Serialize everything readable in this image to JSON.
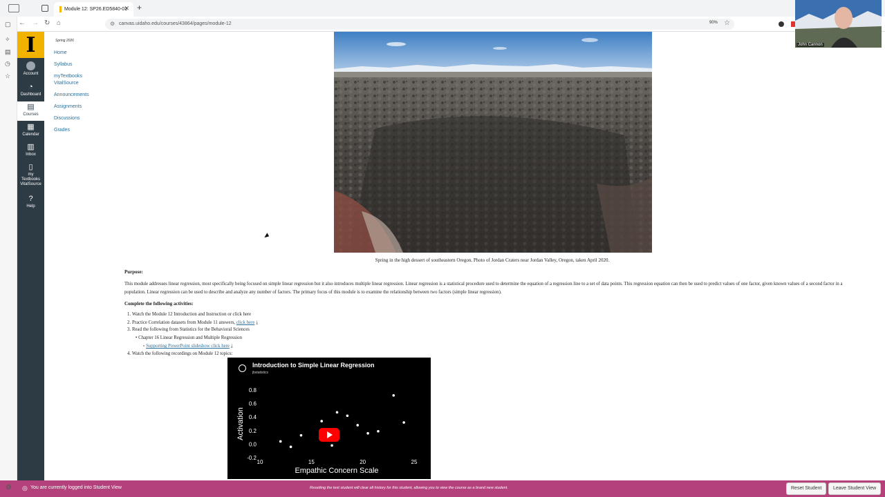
{
  "browser": {
    "tab_title": "Module 12: SP26.ED5840-01",
    "tab_close": "✕",
    "new_tab": "+",
    "url": "canvas.uidaho.edu/courses/43864/pages/module-12",
    "zoom": "90%"
  },
  "global_nav": {
    "logo": "I",
    "items": [
      {
        "label": "Account",
        "icon": "account-icon"
      },
      {
        "label": "Dashboard",
        "icon": "dashboard-icon",
        "glyph": "◔"
      },
      {
        "label": "Courses",
        "icon": "courses-icon",
        "glyph": "▤"
      },
      {
        "label": "Calendar",
        "icon": "calendar-icon",
        "glyph": "▦"
      },
      {
        "label": "Inbox",
        "icon": "inbox-icon",
        "glyph": "▥"
      },
      {
        "label": "my Textbooks VitalSource",
        "icon": "book-icon",
        "glyph": "▯"
      },
      {
        "label": "Help",
        "icon": "help-icon",
        "glyph": "?"
      }
    ]
  },
  "course_nav": {
    "term": "Spring 2026",
    "links": [
      "Home",
      "Syllabus",
      "myTextbooks VitalSource",
      "Announcements",
      "Assignments",
      "Discussions",
      "Grades"
    ]
  },
  "page": {
    "caption": "Spring in the high dessert of southeastern Oregon.  Photo of Jordan Craters near Jordan Valley, Oregon, taken April 2020.",
    "purpose_heading": "Purpose:",
    "purpose_text": "This module addresses linear regression, most specifically being focused on simple linear regression but it also introduces multiple linear regression.  Linear regression is a statistical procedure used to determine the equation of a regression line to a set of data points.  This regression equation can then be used to predict values of one factor, given known values of a second factor in a population.  Linear regression can be used to describe and analyze any number of factors. The primary focus of this module is to examine the relationship between two factors (simple linear regression).",
    "activities_heading": "Complete the following activities:",
    "activities": {
      "a1": "Watch the Module 12 Introduction and Instruction    or click here",
      "a2_text": "Practice Correlation datasets from Module 11 answers,",
      "a2_link": "click here",
      "a3": "Read the following from Statistics for the Behavioral Sciences",
      "a3_sub": "Chapter 16 Linear Regression and Multiple Regression",
      "a3_subsub_link": "Supporting PowerPoint slideshow click here",
      "a4": "Watch the following recordings on Module 12 topics:"
    },
    "video": {
      "title": "Introduction to Simple Linear Regression",
      "channel": "jbstatistics"
    }
  },
  "chart_data": {
    "type": "scatter",
    "xlabel": "Empathic Concern Scale",
    "ylabel": "Activation",
    "xlim": [
      10,
      25
    ],
    "ylim": [
      -0.2,
      0.8
    ],
    "xticks": [
      "10",
      "15",
      "20",
      "25"
    ],
    "yticks": [
      "0.8",
      "0.6",
      "0.4",
      "0.2",
      "0.0",
      "-0.2"
    ],
    "points": [
      {
        "x": 12,
        "y": 0.04
      },
      {
        "x": 13,
        "y": -0.04
      },
      {
        "x": 14,
        "y": 0.13
      },
      {
        "x": 16,
        "y": 0.34
      },
      {
        "x": 17,
        "y": -0.02
      },
      {
        "x": 17.5,
        "y": 0.17
      },
      {
        "x": 17.5,
        "y": 0.47
      },
      {
        "x": 18.5,
        "y": 0.42
      },
      {
        "x": 19.5,
        "y": 0.28
      },
      {
        "x": 20.5,
        "y": 0.16
      },
      {
        "x": 21.5,
        "y": 0.19
      },
      {
        "x": 23,
        "y": 0.72
      },
      {
        "x": 24,
        "y": 0.32
      }
    ],
    "color": "#ffffff"
  },
  "webcam": {
    "name": "John Cannon"
  },
  "student_view": {
    "status": "You are currently logged into Student View",
    "notice": "Resetting the test student will clear all history for this student, allowing you to view the course as a brand new student.",
    "reset_label": "Reset Student",
    "leave_label": "Leave Student View"
  },
  "colors": {
    "canvas_nav": "#2d3b45",
    "brand": "#f1b300",
    "link": "#2b6f9a",
    "student_bar": "#b4417c"
  }
}
